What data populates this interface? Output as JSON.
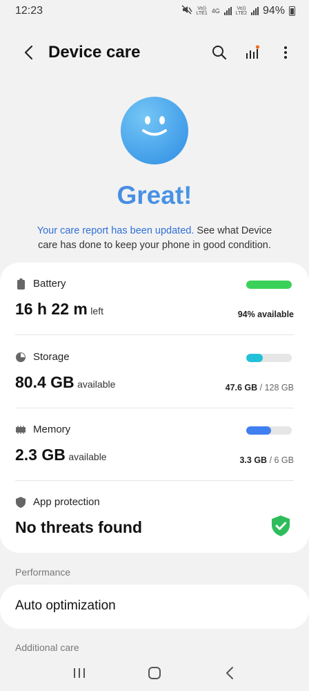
{
  "status_bar": {
    "time": "12:23",
    "sim1_label": "Vo))",
    "sim1_sub": "LTE1",
    "net_type": "4G",
    "sim2_label": "Vo))",
    "sim2_sub": "LTE2",
    "battery_percent": "94%",
    "icons": [
      "mute-icon",
      "signal-icon",
      "battery-icon"
    ]
  },
  "header": {
    "title": "Device care",
    "icons": [
      "back-icon",
      "search-icon",
      "stats-icon",
      "more-icon"
    ]
  },
  "hero": {
    "status": "Great!",
    "message_link": "Your care report has been updated.",
    "message_rest": " See what Device care has done to keep your phone in good condition."
  },
  "battery": {
    "label": "Battery",
    "value": "16 h 22 m",
    "unit": "left",
    "right_text": "94% available",
    "fill_fraction": 1.0,
    "color": "#3ad15a"
  },
  "storage": {
    "label": "Storage",
    "value": "80.4 GB",
    "unit": "available",
    "used": "47.6 GB",
    "total": " / 128 GB",
    "fill_fraction": 0.37,
    "color": "#22c1d9"
  },
  "memory": {
    "label": "Memory",
    "value": "2.3 GB",
    "unit": "available",
    "used": "3.3 GB",
    "total": " / 6 GB",
    "fill_fraction": 0.55,
    "color": "#3f7fef"
  },
  "protection": {
    "label": "App protection",
    "value": "No threats found",
    "shield_color": "#2ebd5b"
  },
  "performance": {
    "section_label": "Performance",
    "item": "Auto optimization"
  },
  "additional": {
    "section_label": "Additional care"
  },
  "nav": {
    "icons": [
      "recents-icon",
      "home-icon",
      "back-nav-icon"
    ]
  }
}
